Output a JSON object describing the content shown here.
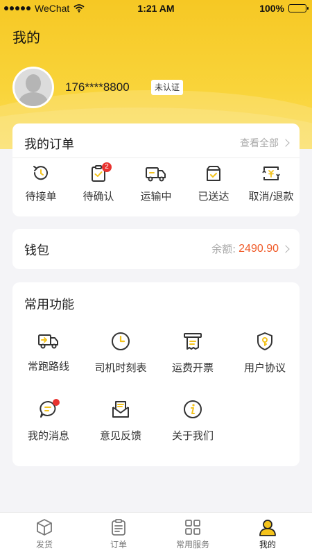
{
  "status_bar": {
    "carrier": "WeChat",
    "time": "1:21 AM",
    "battery": "100%"
  },
  "header": {
    "title": "我的"
  },
  "profile": {
    "phone": "176****8800",
    "verify_status": "未认证"
  },
  "orders": {
    "title": "我的订单",
    "see_all": "查看全部",
    "items": [
      {
        "label": "待接单",
        "icon": "refresh-clock-icon"
      },
      {
        "label": "待确认",
        "icon": "clipboard-check-icon",
        "badge": "2"
      },
      {
        "label": "运输中",
        "icon": "truck-icon"
      },
      {
        "label": "已送达",
        "icon": "box-check-icon"
      },
      {
        "label": "取消/退款",
        "icon": "refund-icon"
      }
    ]
  },
  "wallet": {
    "title": "钱包",
    "balance_label": "余额:",
    "balance_value": "2490.90"
  },
  "functions": {
    "title": "常用功能",
    "items": [
      {
        "label": "常跑路线",
        "icon": "truck-route-icon"
      },
      {
        "label": "司机时刻表",
        "icon": "clock-icon"
      },
      {
        "label": "运费开票",
        "icon": "invoice-icon"
      },
      {
        "label": "用户协议",
        "icon": "shield-key-icon"
      },
      {
        "label": "我的消息",
        "icon": "chat-bubble-icon",
        "has_dot": true
      },
      {
        "label": "意见反馈",
        "icon": "envelope-icon"
      },
      {
        "label": "关于我们",
        "icon": "info-icon"
      }
    ]
  },
  "tabbar": {
    "items": [
      {
        "label": "发货",
        "icon": "cube-icon",
        "active": false
      },
      {
        "label": "订单",
        "icon": "clipboard-icon",
        "active": false
      },
      {
        "label": "常用服务",
        "icon": "grid-icon",
        "active": false
      },
      {
        "label": "我的",
        "icon": "person-icon",
        "active": true
      }
    ]
  },
  "colors": {
    "accent_yellow": "#f9d43a",
    "icon_yellow": "#f4c31c",
    "amount_orange": "#f05a28",
    "badge_red": "#e8332f"
  }
}
